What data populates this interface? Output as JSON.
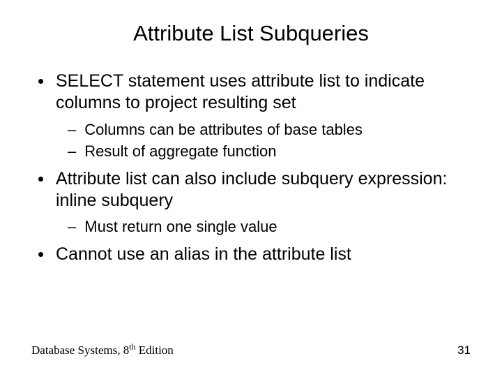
{
  "title": "Attribute List Subqueries",
  "bullets": {
    "b1": "SELECT statement uses attribute list to indicate columns to project resulting set",
    "b1_1": "Columns can be attributes of base tables",
    "b1_2": "Result of aggregate function",
    "b2": "Attribute list can also include subquery expression: inline subquery",
    "b2_1": "Must return one single value",
    "b3": "Cannot use an alias in the attribute list"
  },
  "footer": {
    "text_prefix": "Database Systems, 8",
    "text_sup": "th",
    "text_suffix": " Edition",
    "page": "31"
  }
}
